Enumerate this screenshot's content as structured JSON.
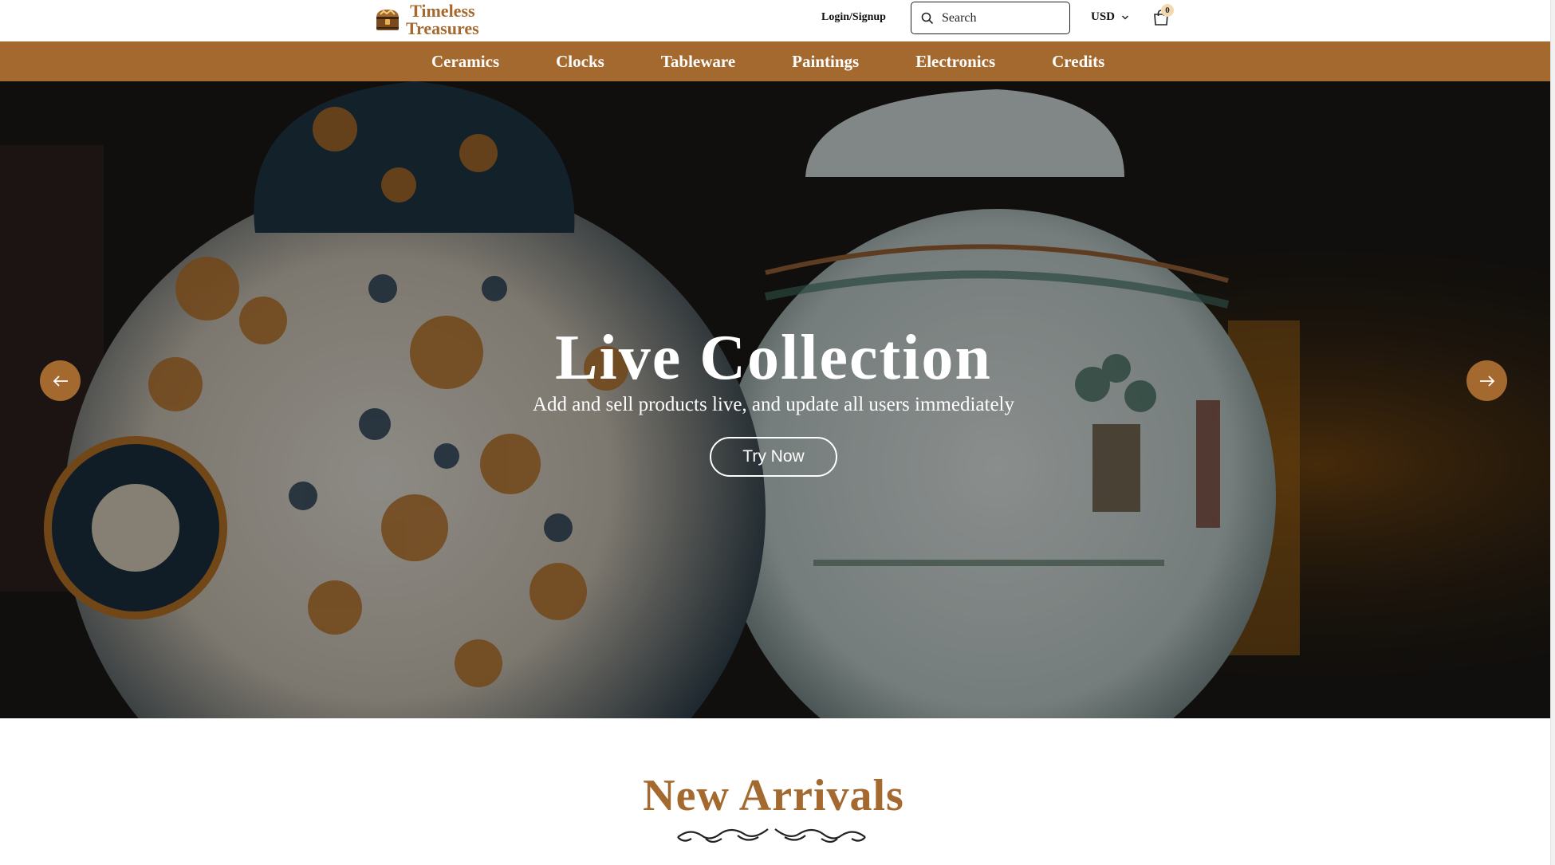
{
  "header": {
    "logo_line1": "Timeless",
    "logo_line2": "Treasures",
    "login_label": "Login/Signup",
    "search_placeholder": "Search",
    "currency": "USD",
    "cart_count": "0"
  },
  "categories": [
    "Ceramics",
    "Clocks",
    "Tableware",
    "Paintings",
    "Electronics",
    "Credits"
  ],
  "hero": {
    "title": "Live Collection",
    "subtitle": "Add and sell products live, and update all users immediately",
    "cta_label": "Try Now"
  },
  "new_arrivals": {
    "title": "New Arrivals"
  },
  "colors": {
    "brand": "#a4692e",
    "badge": "#f2d9b2"
  },
  "icons": {
    "search": "search-icon",
    "currency_dropdown": "chevron-down-icon",
    "cart": "shopping-bag-icon",
    "prev": "arrow-left-icon",
    "next": "arrow-right-icon"
  }
}
